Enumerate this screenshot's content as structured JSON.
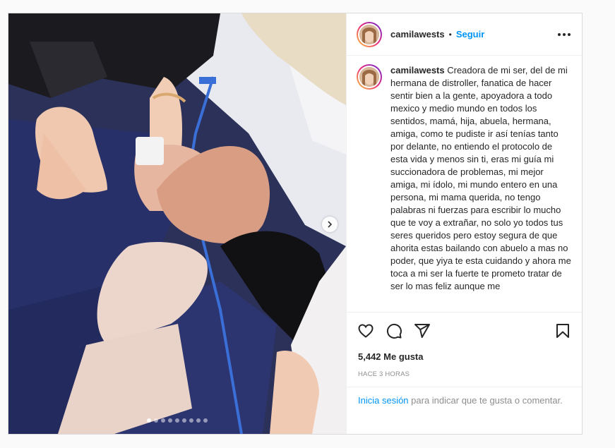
{
  "post": {
    "username": "camilawests",
    "separator": "•",
    "follow_label": "Seguir",
    "caption": "Creadora de mi ser, del de mi hermana de distroller, fanatica de hacer sentir bien a la gente, apoyadora a todo mexico y medio mundo en todos los sentidos, mamá, hija, abuela, hermana, amiga, como te pudiste ir así tenías tanto por delante, no entiendo el protocolo de esta vida y menos sin ti, eras mi guía mi succionadora de problemas, mi mejor amiga, mi ídolo, mi mundo entero en una persona, mi mama querida, no tengo palabras ni fuerzas para escribir lo mucho que te voy a extrañar, no solo yo todos tus seres queridos pero estoy segura de que ahorita estas bailando con abuelo a mas no poder, que yiya te esta cuidando y ahora me toca a mi ser la fuerte te prometo tratar de ser lo mas feliz aunque me",
    "likes": "5,442 Me gusta",
    "timestamp": "HACE 3 HORAS",
    "login_link": "Inicia sesión",
    "login_rest": " para indicar que te gusta o comentar."
  },
  "carousel": {
    "total_slides": 9,
    "active_index": 0
  },
  "icons": {
    "like": "heart-icon",
    "comment": "comment-icon",
    "share": "share-icon",
    "save": "bookmark-icon",
    "more": "more-options-icon",
    "next": "chevron-right-icon"
  },
  "colors": {
    "link_blue": "#0095f6",
    "text": "#262626",
    "muted": "#8e8e8e"
  }
}
